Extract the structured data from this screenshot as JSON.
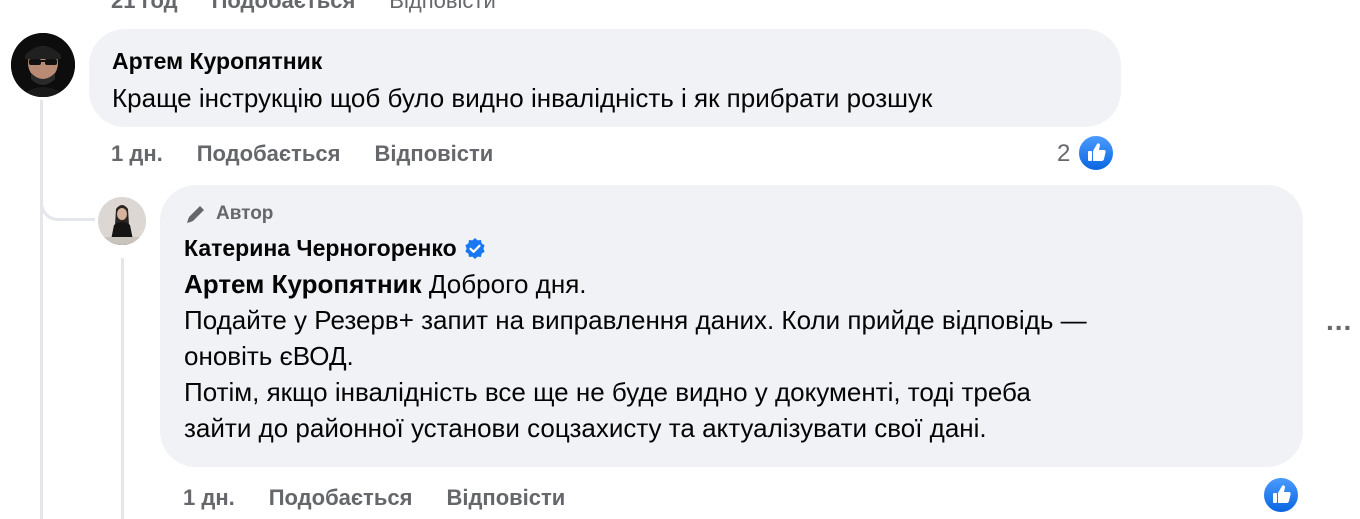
{
  "top_actions": {
    "time": "21 год",
    "like": "Подобається",
    "reply": "Відповісти"
  },
  "comment1": {
    "author": "Артем Куропятник",
    "text": "Краще інструкцію щоб було видно інвалідність і як прибрати розшук",
    "time": "1 дн.",
    "like_label": "Подобається",
    "reply_label": "Відповісти",
    "like_count": "2"
  },
  "reply1": {
    "badge_label": "Автор",
    "author": "Катерина Черногоренко",
    "mention": "Артем Куропятник",
    "line1_rest": " Доброго дня.",
    "line2": "Подайте у Резерв+ запит на виправлення даних. Коли прийде відповідь —",
    "line3": "оновіть єВОД.",
    "line4": "Потім, якщо інвалідність все ще не буде видно у документі, тоді треба",
    "line5": "зайти до районної установи соцзахисту та актуалізувати свої дані.",
    "time": "1 дн.",
    "like_label": "Подобається",
    "reply_label": "Відповісти"
  },
  "more_options": "...",
  "colors": {
    "bubble": "#f0f2f5",
    "secondary_text": "#65676b",
    "like_blue": "#1877f2",
    "verified_blue": "#1877f2"
  },
  "icons": [
    "pencil-icon",
    "verified-badge-icon",
    "thumbs-up-icon",
    "more-options-icon"
  ]
}
